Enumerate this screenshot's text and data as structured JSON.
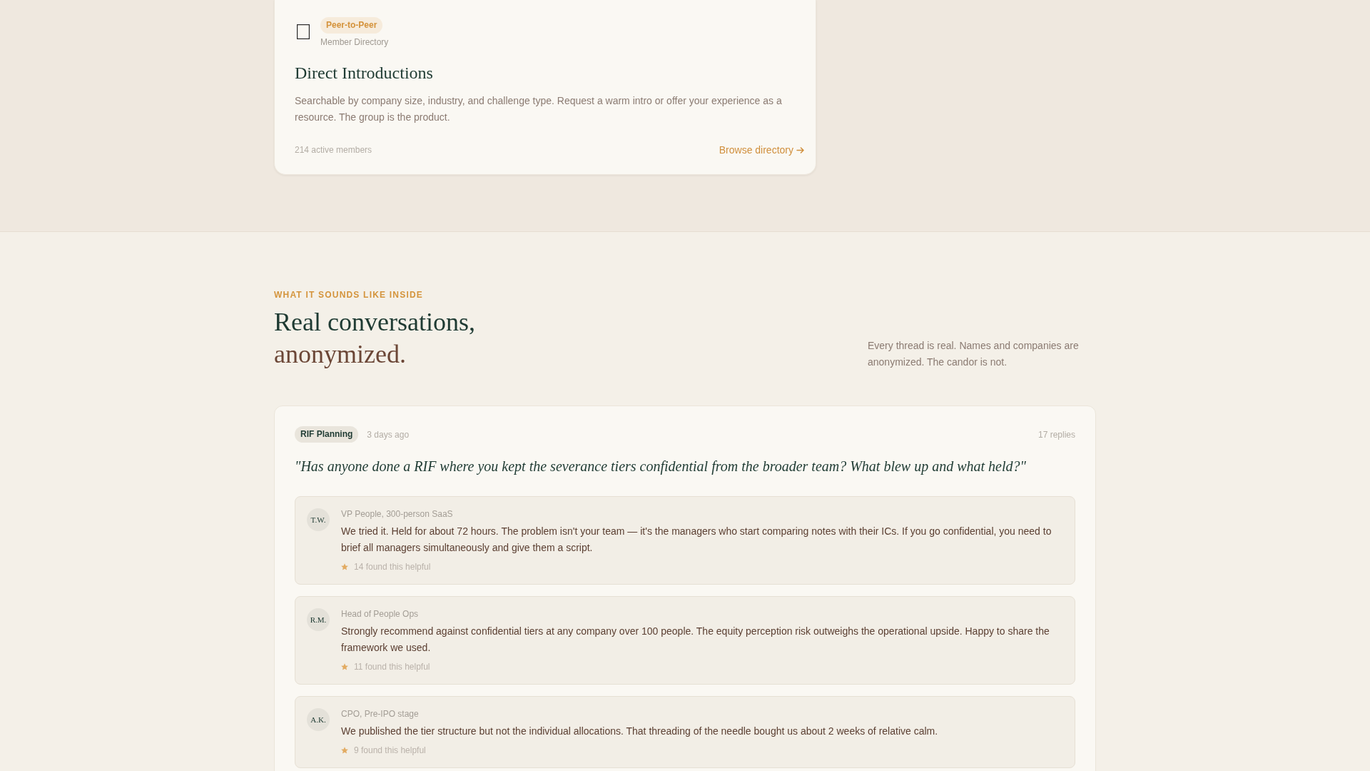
{
  "feature_card": {
    "badge": "Peer-to-Peer",
    "category": "Member Directory",
    "title": "Direct Introductions",
    "description": "Searchable by company size, industry, and challenge type. Request a warm intro or offer your experience as a resource. The group is the product.",
    "stat": "214 active members",
    "link": "Browse directory"
  },
  "conversations": {
    "eyebrow": "WHAT IT SOUNDS LIKE INSIDE",
    "heading": "Real conversations,",
    "heading_accent": "anonymized.",
    "note": "Every thread is real. Names and companies are anonymized. The candor is not."
  },
  "thread": {
    "tag": "RIF Planning",
    "time": "3 days ago",
    "reply_count": "17 replies",
    "question": "\"Has anyone done a RIF where you kept the severance tiers confidential from the broader team? What blew up and what held?\"",
    "replies": [
      {
        "initials": "T.W.",
        "role": "VP People, 300-person SaaS",
        "text": "We tried it. Held for about 72 hours. The problem isn't your team — it's the managers who start comparing notes with their ICs. If you go confidential, you need to brief all managers simultaneously and give them a script.",
        "helpful": "14 found this helpful"
      },
      {
        "initials": "R.M.",
        "role": "Head of People Ops",
        "text": "Strongly recommend against confidential tiers at any company over 100 people. The equity perception risk outweighs the operational upside. Happy to share the framework we used.",
        "helpful": "11 found this helpful"
      },
      {
        "initials": "A.K.",
        "role": "CPO, Pre-IPO stage",
        "text": "We published the tier structure but not the individual allocations. That threading of the needle bought us about 2 weeks of relative calm.",
        "helpful": "9 found this helpful"
      }
    ]
  }
}
